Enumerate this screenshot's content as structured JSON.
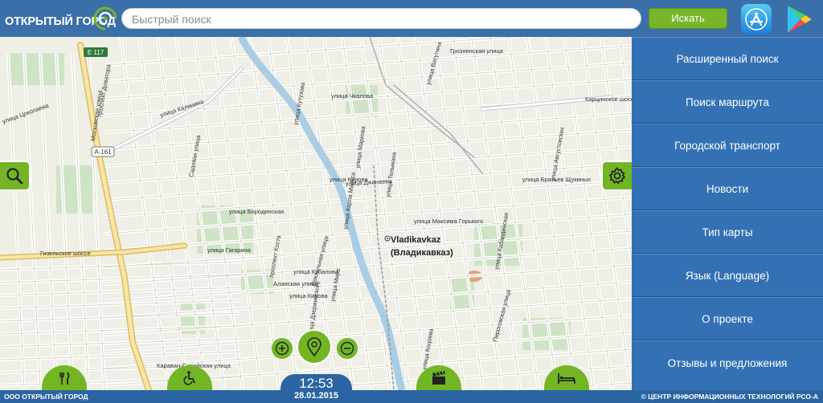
{
  "header": {
    "logo_text": "ОТКРЫТЫЙ ГОРОД",
    "search_placeholder": "Быстрый поиск",
    "search_button": "Искать"
  },
  "icons": {
    "app_store": "app-store-icon",
    "google_play": "google-play-icon",
    "search": "magnifier-icon",
    "settings": "gear-icon",
    "zoom_in": "plus-icon",
    "zoom_out": "minus-icon",
    "locate": "map-pin-icon",
    "food": "fork-knife-icon",
    "accessibility": "wheelchair-icon",
    "cinema": "clapperboard-icon",
    "hotel": "bed-icon"
  },
  "menu": {
    "items": [
      "Расширенный поиск",
      "Поиск маршрута",
      "Городской транспорт",
      "Новости",
      "Тип карты",
      "Язык (Language)",
      "О проекте",
      "Отзывы и предложения"
    ]
  },
  "map": {
    "city_label": "Vladikavkaz",
    "city_label_local": "(Владикавказ)",
    "shields": [
      "E 117",
      "A-161"
    ],
    "streets": [
      "улица Калинина",
      "проспект Доватора",
      "Московская улица",
      "Гизельское шоссе",
      "улица Цоколаева",
      "улица Ватутина",
      "улица Кирова",
      "улица Максима Горького",
      "улица Братьев Щукиных",
      "Карцинское шоссе",
      "Грозненская улица",
      "улица Джанаева",
      "улица Тельмана",
      "Садовая улица",
      "улица Кутузова",
      "улица Кабардинская",
      "улица Августовских",
      "улица Чкалова",
      "улица Маркова",
      "проспект Коста",
      "улица Гагарина",
      "улица Бородинская",
      "Аланская улица",
      "улица Кирова",
      "улица Кубалова",
      "улица Карла Маркса",
      "улица Дзержинского",
      "Вокзальная улица",
      "улица Мира",
      "Пироговская улица",
      "улица Коцоева",
      "Караван-Сарайская улица"
    ]
  },
  "colors": {
    "header": "#3a6fa9",
    "menu": "#3471b4",
    "accent_green": "#72b624",
    "river": "#a9cde5",
    "park": "#cfe4c6"
  },
  "footer": {
    "left": "ООО ОТКРЫТЫЙ ГОРОД",
    "right": "© ЦЕНТР ИНФОРМАЦИОННЫХ ТЕХНОЛОГИЙ РСО-А",
    "time": "12:53",
    "date": "28.01.2015"
  }
}
